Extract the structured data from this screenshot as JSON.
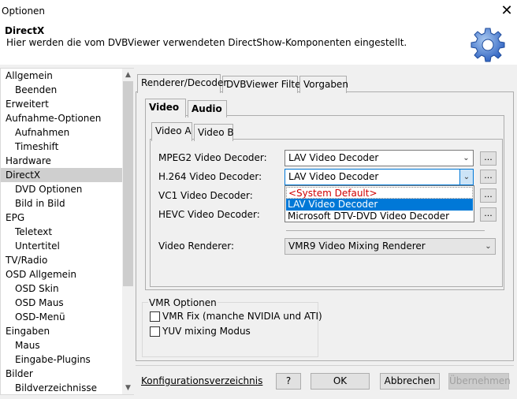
{
  "window": {
    "title": "Optionen",
    "close_glyph": "✕"
  },
  "header": {
    "title": "DirectX",
    "description": "Hier werden die vom DVBViewer verwendeten DirectShow-Komponenten eingestellt.",
    "icon": "gear-icon"
  },
  "sidebar": {
    "items": [
      {
        "label": "Allgemein",
        "level": 0
      },
      {
        "label": "Beenden",
        "level": 1
      },
      {
        "label": "Erweitert",
        "level": 0
      },
      {
        "label": "Aufnahme-Optionen",
        "level": 0
      },
      {
        "label": "Aufnahmen",
        "level": 1
      },
      {
        "label": "Timeshift",
        "level": 1
      },
      {
        "label": "Hardware",
        "level": 0
      },
      {
        "label": "DirectX",
        "level": 0,
        "selected": true
      },
      {
        "label": "DVD Optionen",
        "level": 1
      },
      {
        "label": "Bild in Bild",
        "level": 1
      },
      {
        "label": "EPG",
        "level": 0
      },
      {
        "label": "Teletext",
        "level": 1
      },
      {
        "label": "Untertitel",
        "level": 1
      },
      {
        "label": "TV/Radio",
        "level": 0
      },
      {
        "label": "OSD Allgemein",
        "level": 0
      },
      {
        "label": "OSD Skin",
        "level": 1
      },
      {
        "label": "OSD Maus",
        "level": 1
      },
      {
        "label": "OSD-Menü",
        "level": 1
      },
      {
        "label": "Eingaben",
        "level": 0
      },
      {
        "label": "Maus",
        "level": 1
      },
      {
        "label": "Eingabe-Plugins",
        "level": 1
      },
      {
        "label": "Bilder",
        "level": 0
      },
      {
        "label": "Bildverzeichnisse",
        "level": 1
      }
    ],
    "scroll_up": "▲",
    "scroll_down": "▼"
  },
  "tabs": {
    "outer": [
      "Renderer/Decoder",
      "DVBViewer Filter",
      "Vorgaben"
    ],
    "middle": [
      "Video",
      "Audio"
    ],
    "inner": [
      "Video A",
      "Video B"
    ]
  },
  "decoders": {
    "mpeg2_label": "MPEG2 Video Decoder:",
    "mpeg2_value": "LAV Video Decoder",
    "h264_label": "H.264 Video Decoder:",
    "h264_value": "LAV Video Decoder",
    "vc1_label": "VC1 Video Decoder:",
    "hevc_label": "HEVC Video Decoder:",
    "renderer_label": "Video Renderer:",
    "renderer_value": "VMR9 Video Mixing Renderer",
    "dots": "...",
    "dropdown_options": [
      "<System Default>",
      "LAV Video Decoder",
      "Microsoft DTV-DVD Video Decoder"
    ],
    "dropdown_selected_index": 1,
    "combo_arrow": "⌄"
  },
  "vmr": {
    "group_title": "VMR Optionen",
    "fix_label": "VMR Fix (manche NVIDIA und ATI)",
    "yuv_label": "YUV mixing Modus",
    "fix_checked": false,
    "yuv_checked": false
  },
  "footer": {
    "config_link": "Konfigurationsverzeichnis",
    "help": "?",
    "ok": "OK",
    "cancel": "Abbrechen",
    "apply": "Übernehmen"
  },
  "colors": {
    "accent": "#0078d7",
    "selection_bg": "#cfcfcf",
    "system_default_text": "#d00000"
  }
}
